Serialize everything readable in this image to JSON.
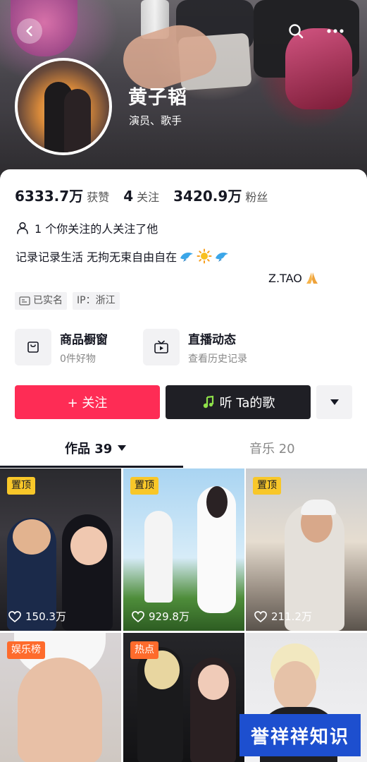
{
  "profile": {
    "name": "黄子韬",
    "subtitle": "演员、歌手",
    "stats": [
      {
        "value": "6333.7万",
        "label": "获赞"
      },
      {
        "value": "4",
        "label": "关注"
      },
      {
        "value": "3420.9万",
        "label": "粉丝"
      }
    ],
    "mutual": "1 个你关注的人关注了他",
    "bio_line1": "记录记录生活 无拘无束自由自在",
    "bio_line1_emojis": [
      "dolphin",
      "sun",
      "dolphin"
    ],
    "bio_line2": "Z.TAO",
    "bio_line2_emoji": "folded-hands",
    "tags": [
      {
        "icon": "id-card-icon",
        "text": "已实名"
      },
      {
        "icon": "",
        "text": "IP：浙江"
      }
    ]
  },
  "services": [
    {
      "icon": "shopping-bag-icon",
      "title": "商品橱窗",
      "subtitle": "0件好物"
    },
    {
      "icon": "live-tv-icon",
      "title": "直播动态",
      "subtitle": "查看历史记录"
    }
  ],
  "actions": {
    "follow": "+ 关注",
    "song": "听 Ta的歌"
  },
  "tabs": {
    "works": "作品 39",
    "music": "音乐 20"
  },
  "videos": [
    {
      "badge": "置顶",
      "badge_type": "pin",
      "likes": "150.3万"
    },
    {
      "badge": "置顶",
      "badge_type": "pin",
      "likes": "929.8万"
    },
    {
      "badge": "置顶",
      "badge_type": "pin",
      "likes": "211.2万"
    },
    {
      "badge": "娱乐榜",
      "badge_type": "hot",
      "likes": ""
    },
    {
      "badge": "热点",
      "badge_type": "hot",
      "likes": ""
    },
    {
      "badge": "",
      "badge_type": "",
      "likes": ""
    }
  ],
  "watermark": "誉祥祥知识",
  "colors": {
    "accent": "#fe2c55",
    "dark_button": "#1f1f25",
    "pin_badge": "#f8c729",
    "hot_badge": "#fe6b2c"
  }
}
